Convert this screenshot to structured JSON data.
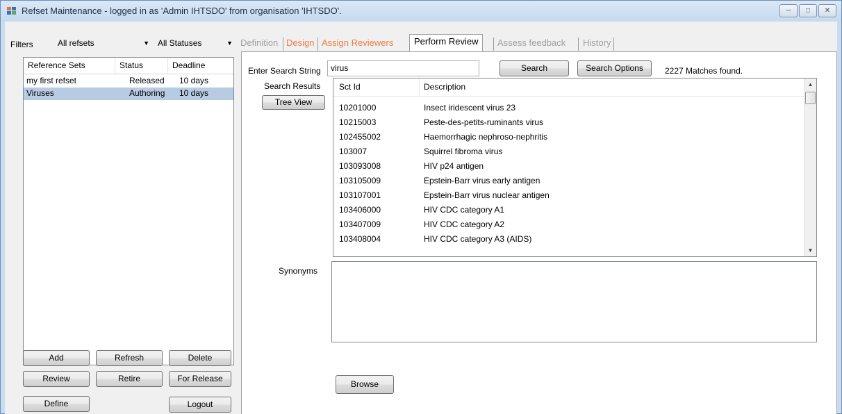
{
  "window": {
    "title": "Refset Maintenance - logged in as 'Admin IHTSDO' from organisation 'IHTSDO'.",
    "controls": [
      "minimize-icon",
      "maximize-icon",
      "close-icon"
    ]
  },
  "filters": {
    "label": "Filters",
    "refset_filter": "All refsets",
    "status_filter": "All Statuses"
  },
  "refsets": {
    "columns": [
      "Reference Sets",
      "Status",
      "Deadline"
    ],
    "rows": [
      {
        "name": "my first refset",
        "status": "Released",
        "deadline": "10 days",
        "selected": false
      },
      {
        "name": "Viruses",
        "status": "Authoring",
        "deadline": "10 days",
        "selected": true
      }
    ]
  },
  "buttons": {
    "add": "Add",
    "refresh": "Refresh",
    "delete": "Delete",
    "review": "Review",
    "retire": "Retire",
    "for_release": "For Release",
    "define": "Define",
    "logout": "Logout"
  },
  "tabs": [
    {
      "label": "Definition",
      "state": "disabled"
    },
    {
      "label": "Design",
      "state": "orange"
    },
    {
      "label": "Assign Reviewers",
      "state": "orange"
    },
    {
      "label": "Perform Review",
      "state": "active"
    },
    {
      "label": "Assess feedback",
      "state": "disabled"
    },
    {
      "label": "History",
      "state": "disabled"
    }
  ],
  "review": {
    "search_label": "Enter Search String",
    "search_value": "virus",
    "search_button": "Search",
    "search_options_button": "Search Options",
    "matches": "2227 Matches found.",
    "results_label": "Search Results",
    "tree_view_button": "Tree View",
    "results_columns": [
      "Sct Id",
      "Description"
    ],
    "results": [
      {
        "id": "10201000",
        "desc": "Insect iridescent virus 23"
      },
      {
        "id": "10215003",
        "desc": "Peste-des-petits-ruminants virus"
      },
      {
        "id": "102455002",
        "desc": "Haemorrhagic nephroso-nephritis"
      },
      {
        "id": "103007",
        "desc": "Squirrel fibroma virus"
      },
      {
        "id": "103093008",
        "desc": "HIV p24 antigen"
      },
      {
        "id": "103105009",
        "desc": "Epstein-Barr virus early antigen"
      },
      {
        "id": "103107001",
        "desc": "Epstein-Barr virus nuclear antigen"
      },
      {
        "id": "103406000",
        "desc": "HIV CDC category A1"
      },
      {
        "id": "103407009",
        "desc": "HIV CDC category A2"
      },
      {
        "id": "103408004",
        "desc": "HIV CDC category A3 (AIDS)"
      }
    ],
    "synonyms_label": "Synonyms",
    "browse_button": "Browse"
  }
}
